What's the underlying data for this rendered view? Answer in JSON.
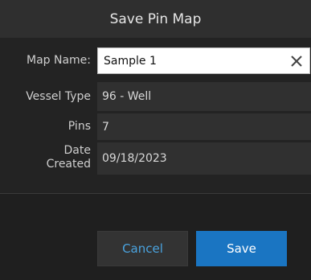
{
  "dialog": {
    "title": "Save Pin Map",
    "map_name": {
      "label": "Map Name:",
      "value": "Sample 1"
    },
    "vessel_type": {
      "label": "Vessel Type",
      "value": "96 - Well"
    },
    "pins": {
      "label": "Pins",
      "value": "7"
    },
    "date_created": {
      "label_line1": "Date",
      "label_line2": "Created",
      "value": "09/18/2023"
    },
    "buttons": {
      "cancel": "Cancel",
      "save": "Save"
    }
  },
  "colors": {
    "accent": "#1a75c2",
    "cancel_text": "#4aa3df",
    "background": "#232323"
  },
  "icons": {
    "clear": "close-icon"
  }
}
